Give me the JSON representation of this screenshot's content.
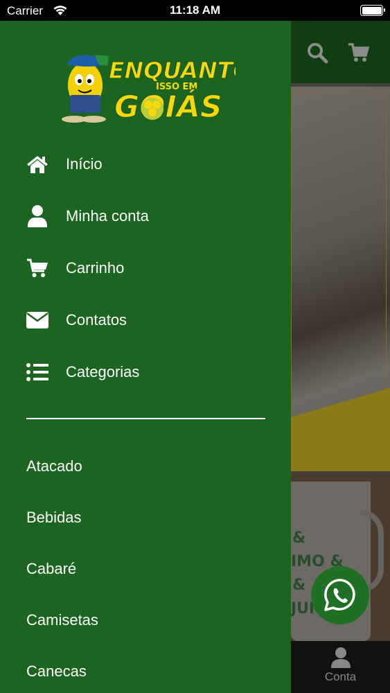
{
  "status_bar": {
    "carrier": "Carrier",
    "time": "11:18 AM"
  },
  "brand": {
    "logo_line1": "ENQUANTO",
    "logo_line2": "ISSO EM",
    "logo_line3": "GOIÁS",
    "colors": {
      "drawer": "#1c6520",
      "logo_yellow": "#f5d90c",
      "whatsapp": "#1f6f24"
    }
  },
  "menu": {
    "items": [
      {
        "label": "Início",
        "icon": "home-icon"
      },
      {
        "label": "Minha conta",
        "icon": "user-icon"
      },
      {
        "label": "Carrinho",
        "icon": "cart-icon"
      },
      {
        "label": "Contatos",
        "icon": "envelope-icon"
      },
      {
        "label": "Categorias",
        "icon": "list-icon"
      }
    ]
  },
  "categories": [
    "Atacado",
    "Bebidas",
    "Cabaré",
    "Camisetas",
    "Canecas"
  ],
  "background": {
    "tab_label": "Conta",
    "mug_lines": [
      "&",
      "IMO &",
      "&",
      "JUM T"
    ]
  }
}
